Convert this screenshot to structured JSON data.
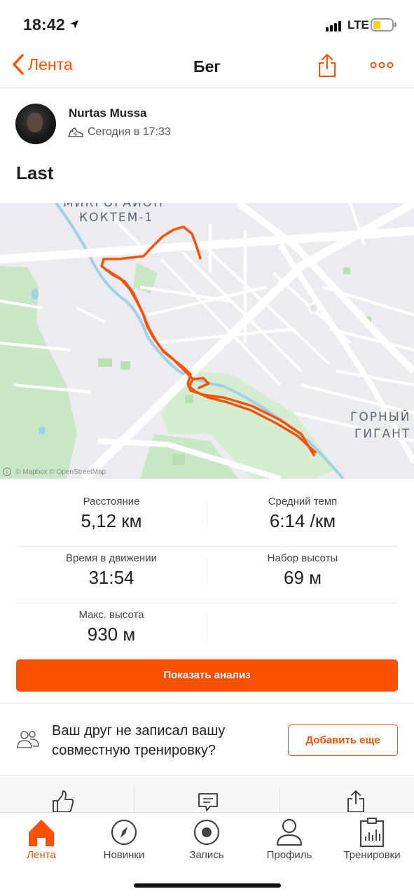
{
  "status_bar": {
    "time": "18:42",
    "network": "LTE",
    "battery_level": 0.3
  },
  "header": {
    "back_label": "Лента",
    "title": "Бег"
  },
  "author": {
    "name": "Nurtas Mussa",
    "timestamp": "Сегодня в 17:33"
  },
  "activity": {
    "title": "Last"
  },
  "map": {
    "labels": {
      "district_top_line1": "МИКРОРАЙОН",
      "district_top_line2": "КОКТЕМ-1",
      "district_right_line1": "ГОРНЫЙ",
      "district_right_line2": "ГИГАНТ"
    },
    "attribution": "© Mapbox © OpenStreetMap",
    "route_color": "#fc5200"
  },
  "stats": {
    "distance": {
      "label": "Расстояние",
      "value": "5,12 км"
    },
    "pace": {
      "label": "Средний темп",
      "value": "6:14 /км"
    },
    "moving_time": {
      "label": "Время в движении",
      "value": "31:54"
    },
    "elevation_gain": {
      "label": "Набор высоты",
      "value": "69 м"
    },
    "max_elevation": {
      "label": "Макс. высота",
      "value": "930 м"
    }
  },
  "analysis_button": "Показать анализ",
  "friend_prompt": {
    "text": "Ваш друг не записал вашу совместную тренировку?",
    "button": "Добавить еще"
  },
  "tabs": [
    {
      "label": "Лента",
      "icon": "home-icon",
      "active": true
    },
    {
      "label": "Новинки",
      "icon": "compass-icon",
      "active": false
    },
    {
      "label": "Запись",
      "icon": "record-icon",
      "active": false
    },
    {
      "label": "Профиль",
      "icon": "profile-icon",
      "active": false
    },
    {
      "label": "Тренировки",
      "icon": "training-log-icon",
      "active": false
    }
  ],
  "colors": {
    "accent": "#fc5200",
    "map_bg": "#ececf0",
    "park": "#c7e6c4"
  }
}
